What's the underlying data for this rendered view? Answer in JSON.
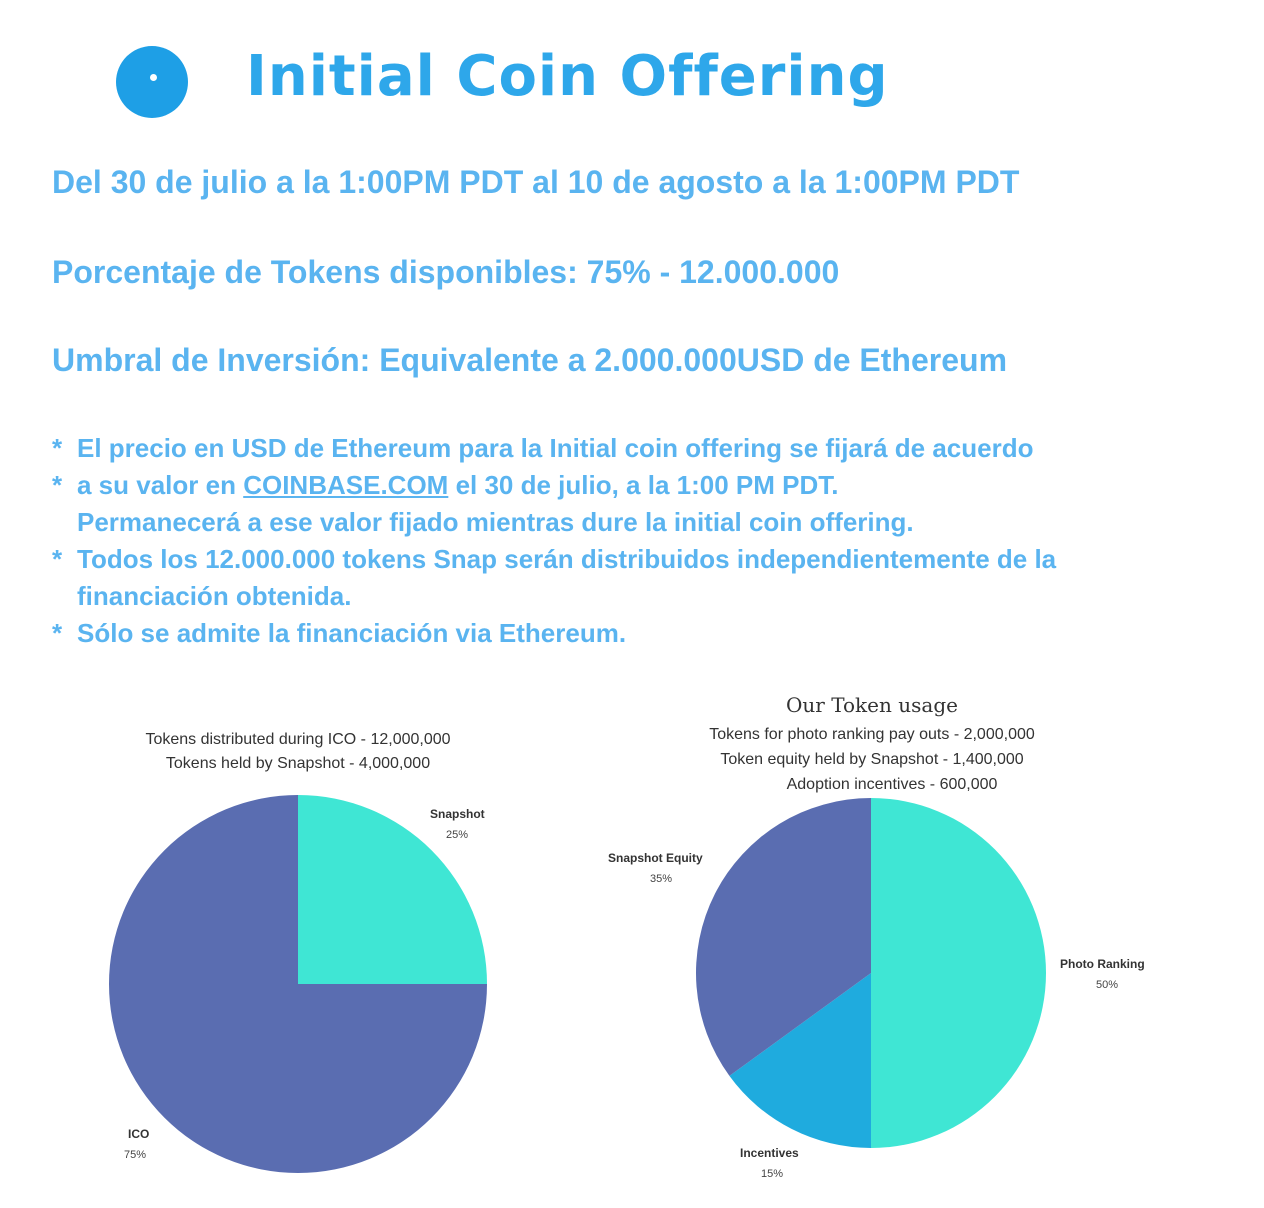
{
  "header": {
    "title": "Initial Coin Offering",
    "logo_icon": "coin-icon",
    "accent_color": "#2ea7ea"
  },
  "info": {
    "dates": "Del 30 de julio a la 1:00PM PDT al 10 de agosto a la 1:00PM PDT",
    "tokens_available": "Porcentaje de Tokens disponibles: 75% - 12.000.000",
    "threshold": "Umbral de Inversión: Equivalente a 2.000.000USD de Ethereum"
  },
  "notes": {
    "bullet": "*",
    "note1": "El precio en USD de Ethereum para la Initial coin offering se fijará de acuerdo",
    "note2_prefix": "a su valor en",
    "note2_link": "COINBASE.COM",
    "note2_suffix": "el 30 de julio, a la 1:00 PM PDT.",
    "note2_cont": "Permanecerá a ese valor fijado mientras dure la initial coin offering.",
    "note3": "Todos los 12.000.000 tokens Snap serán distribuidos independientemente de la",
    "note3_cont": "financiación obtenida.",
    "note4": "Sólo se admite la financiación via Ethereum."
  },
  "chart_data": [
    {
      "type": "pie",
      "title": "",
      "subtitle_lines": [
        "Tokens distributed during ICO - 12,000,000",
        "Tokens held by Snapshot - 4,000,000"
      ],
      "slices": [
        {
          "label": "Snapshot",
          "value": 25,
          "pct": "25%",
          "color": "#3fe6d4"
        },
        {
          "label": "ICO",
          "value": 75,
          "pct": "75%",
          "color": "#5a6db1"
        }
      ]
    },
    {
      "type": "pie",
      "title": "Our Token usage",
      "subtitle_lines": [
        "Tokens for photo ranking pay outs - 2,000,000",
        "Token equity held by Snapshot - 1,400,000",
        "Adoption incentives - 600,000"
      ],
      "slices": [
        {
          "label": "Photo Ranking",
          "value": 50,
          "pct": "50%",
          "color": "#3fe6d4"
        },
        {
          "label": "Incentives",
          "value": 15,
          "pct": "15%",
          "color": "#1fabde"
        },
        {
          "label": "Snapshot Equity",
          "value": 35,
          "pct": "35%",
          "color": "#5a6db1"
        }
      ]
    }
  ]
}
